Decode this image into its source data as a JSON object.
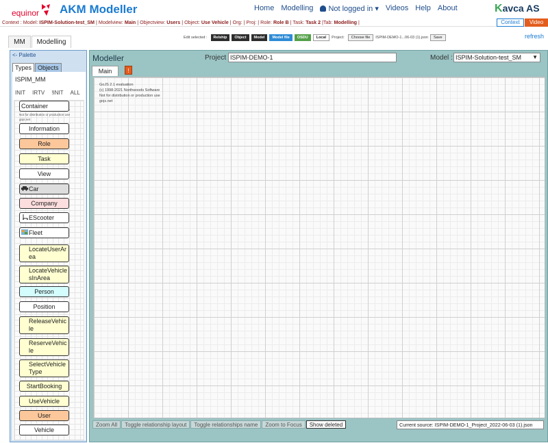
{
  "brand": {
    "company": "equinor",
    "title": "AKM Modeller",
    "partner_prefix": "K",
    "partner": "avca AS"
  },
  "nav": {
    "home": "Home",
    "modelling": "Modelling",
    "user": "Not logged in ▾",
    "videos": "Videos",
    "help": "Help",
    "about": "About"
  },
  "context": {
    "prefix": "Context : Model: ",
    "model": "ISPIM-Solution-test_SM",
    "modelview_lbl": " | Modelview: ",
    "modelview": "Main",
    "objectview_lbl": " | Objectview: ",
    "objectview": "Users",
    "object_lbl": " | Object: ",
    "object": "Use Vehicle",
    "rest1": " | Org: | Proj: | Role: ",
    "role": "Role B",
    "task_lbl": " | Task: ",
    "task": "Task 2",
    "tab_lbl": " |Tab: ",
    "tab": "Modelling",
    "end": " |",
    "context_btn": "Context",
    "video_btn": "Video"
  },
  "tabs": {
    "mm": "MM",
    "modelling": "Modelling",
    "refresh": "refresh"
  },
  "editbar": {
    "label": "Edit selected :",
    "relship": "Relship",
    "object": "Object",
    "model": "Model",
    "modelfile": "Model file",
    "osdu": "OSDU",
    "local": "Local",
    "project_lbl": "Project:",
    "choose": "Choose file",
    "filename": "ISPIM-DEMO-1...06-03 (1).json",
    "save": "Save"
  },
  "palette": {
    "header": "<- Palette",
    "tab_types": "Types",
    "tab_objects": "Objects",
    "mm_name": "ISPIM_MM",
    "init": [
      "INIT",
      "IRTV",
      "!INIT",
      "ALL"
    ],
    "eval_lines": [
      "GoJS 2.1 evaluation",
      "(c) 1998-2021 Northwoods Software",
      "Not for distribution or production use",
      "gojs.net"
    ],
    "items": [
      {
        "label": "Container",
        "bg": "#ffffff"
      },
      {
        "label": "Information",
        "bg": "#ffffff"
      },
      {
        "label": "Role",
        "bg": "#fcc89b"
      },
      {
        "label": "Task",
        "bg": "#ffffd1"
      },
      {
        "label": "View",
        "bg": "#ffffff"
      },
      {
        "label": "Car",
        "bg": "#dddddd",
        "icon": "car-icon"
      },
      {
        "label": "Company",
        "bg": "#fddede"
      },
      {
        "label": "EScooter",
        "bg": "#ffffff",
        "icon": "scooter-icon"
      },
      {
        "label": "Fleet",
        "bg": "#ffffff",
        "icon": "fleet-icon"
      },
      {
        "label": "LocateUserAr\nea",
        "bg": "#ffffd1"
      },
      {
        "label": "LocateVehicle\nsInArea",
        "bg": "#ffffd1"
      },
      {
        "label": "Person",
        "bg": "#d3fcfc"
      },
      {
        "label": "Position",
        "bg": "#ffffff"
      },
      {
        "label": "ReleaseVehic\nle",
        "bg": "#ffffd1"
      },
      {
        "label": "ReserveVehic\nle",
        "bg": "#ffffd1"
      },
      {
        "label": "SelectVehicle\nType",
        "bg": "#ffffd1"
      },
      {
        "label": "StartBooking",
        "bg": "#ffffd1"
      },
      {
        "label": "UseVehicle",
        "bg": "#ffffd1"
      },
      {
        "label": "User",
        "bg": "#fcc89b"
      },
      {
        "label": "Vehicle",
        "bg": "#ffffff"
      }
    ]
  },
  "modeller": {
    "title": "Modeller",
    "project_label": "Project :",
    "project_value": "ISPIM-DEMO-1",
    "model_label": "Model :",
    "model_value": "ISPIM-Solution-test_SM",
    "tab_main": "Main",
    "red_btn": "!",
    "eval_lines": [
      "GoJS 2.1 evaluation",
      "(c) 1998-2021 Northwoods Software",
      "Not for distribution or production use",
      "gojs.net"
    ],
    "buttons": {
      "zoom_all": "Zoom All",
      "toggle_layout": "Toggle relationship layout",
      "toggle_name": "Toggle relationships name",
      "zoom_focus": "Zoom to Focus",
      "show_deleted": "Show deleted"
    },
    "current_source": "Current source: ISPIM-DEMO-1_Project_2022-06-03 (1).json"
  }
}
